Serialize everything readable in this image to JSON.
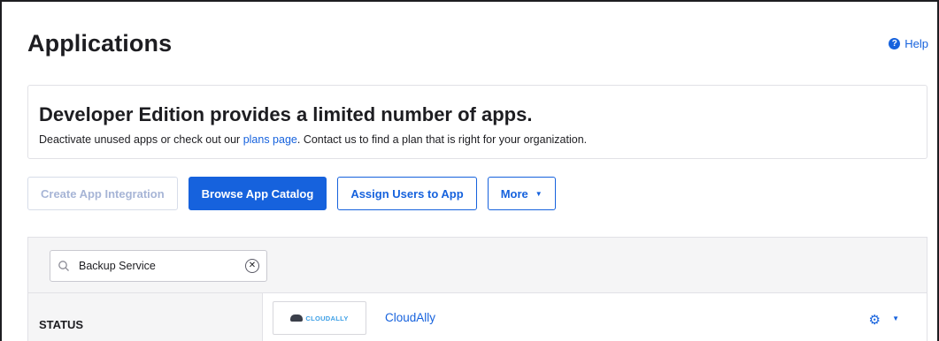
{
  "header": {
    "title": "Applications",
    "help_label": "Help"
  },
  "notice": {
    "title": "Developer Edition provides a limited number of apps.",
    "text_before": "Deactivate unused apps or check out our ",
    "link_label": "plans page",
    "text_after": ". Contact us to find a plan that is right for your organization."
  },
  "actions": {
    "create_label": "Create App Integration",
    "browse_label": "Browse App Catalog",
    "assign_label": "Assign Users to App",
    "more_label": "More"
  },
  "search": {
    "value": "Backup Service",
    "icon": "search-icon"
  },
  "filters": {
    "status_label": "STATUS"
  },
  "apps": [
    {
      "name": "CloudAlly",
      "logo_text": "CLOUDALLY"
    }
  ],
  "colors": {
    "accent": "#1662dd",
    "panel_bg": "#f5f5f6",
    "border": "#e1e1e6"
  }
}
